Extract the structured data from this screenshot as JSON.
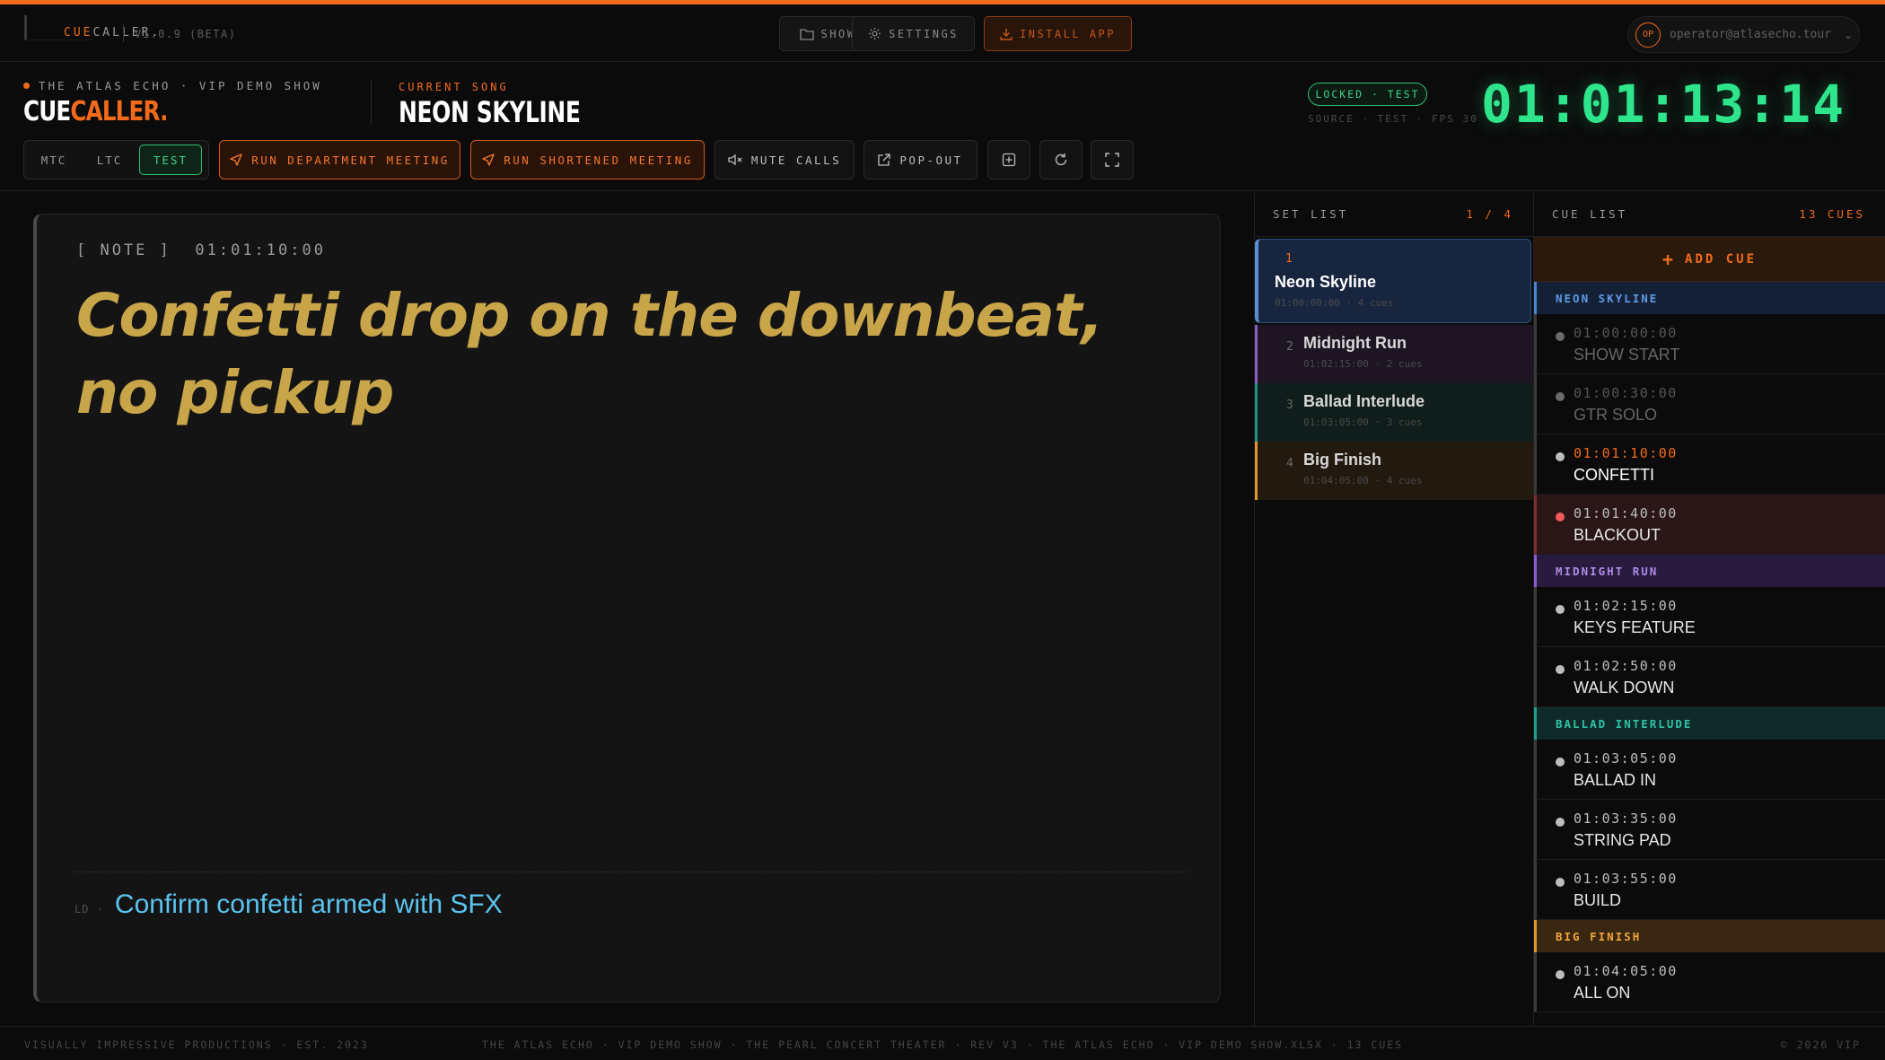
{
  "app": {
    "brand_prefix": "CUE",
    "brand_suffix": "CALLER.",
    "version": "V1.0.9 (BETA)"
  },
  "topnav": {
    "show_label": "SHOW",
    "settings_label": "SETTINGS",
    "install_label": "INSTALL APP",
    "user_initials": "OP",
    "user_email": "operator@atlasecho.tour"
  },
  "header": {
    "show_line": "THE ATLAS ECHO · VIP DEMO SHOW",
    "logo_a": "CUE",
    "logo_b": "CALLER.",
    "current_song_label": "CURRENT SONG",
    "current_song_name": "NEON SKYLINE",
    "lock_status": "LOCKED · TEST",
    "source_line": "SOURCE · TEST · FPS 30",
    "timecode": "01:01:13:14"
  },
  "toolbar": {
    "modes": [
      "MTC",
      "LTC",
      "TEST"
    ],
    "active_mode": "TEST",
    "run_department_meeting": "RUN DEPARTMENT MEETING",
    "run_shortened_meeting": "RUN SHORTENED MEETING",
    "mute_calls": "MUTE CALLS",
    "pop_out": "POP-OUT"
  },
  "note": {
    "tag": "[ NOTE ]",
    "timecode": "01:01:10:00",
    "text": "Confetti drop on the downbeat, no pickup",
    "dept": "LD ·",
    "action": "Confirm confetti armed with SFX"
  },
  "setlist": {
    "title": "SET LIST",
    "count": "1 / 4",
    "songs": [
      {
        "num": "1",
        "title": "Neon Skyline",
        "meta": "01:00:00:00 · 4 cues"
      },
      {
        "num": "2",
        "title": "Midnight Run",
        "meta": "01:02:15:00 · 2 cues"
      },
      {
        "num": "3",
        "title": "Ballad Interlude",
        "meta": "01:03:05:00 · 3 cues"
      },
      {
        "num": "4",
        "title": "Big Finish",
        "meta": "01:04:05:00 · 4 cues"
      }
    ]
  },
  "cuelist": {
    "title": "CUE LIST",
    "count": "13 CUES",
    "add_label": "ADD CUE",
    "sections": [
      {
        "name": "NEON SKYLINE",
        "cues": [
          {
            "tc": "01:00:00:00",
            "name": "SHOW START"
          },
          {
            "tc": "01:00:30:00",
            "name": "GTR SOLO"
          },
          {
            "tc": "01:01:10:00",
            "name": "CONFETTI"
          },
          {
            "tc": "01:01:40:00",
            "name": "BLACKOUT"
          }
        ]
      },
      {
        "name": "MIDNIGHT RUN",
        "cues": [
          {
            "tc": "01:02:15:00",
            "name": "KEYS FEATURE"
          },
          {
            "tc": "01:02:50:00",
            "name": "WALK DOWN"
          }
        ]
      },
      {
        "name": "BALLAD INTERLUDE",
        "cues": [
          {
            "tc": "01:03:05:00",
            "name": "BALLAD IN"
          },
          {
            "tc": "01:03:35:00",
            "name": "STRING PAD"
          },
          {
            "tc": "01:03:55:00",
            "name": "BUILD"
          }
        ]
      },
      {
        "name": "BIG FINISH",
        "cues": [
          {
            "tc": "01:04:05:00",
            "name": "ALL ON"
          }
        ]
      }
    ]
  },
  "footer": {
    "left": "VISUALLY IMPRESSIVE PRODUCTIONS · EST. 2023",
    "center": "THE ATLAS ECHO · VIP DEMO SHOW · THE PEARL CONCERT THEATER · REV V3 · THE ATLAS ECHO · VIP DEMO SHOW.XLSX · 13 CUES",
    "right": "© 2026 VIP"
  },
  "colors": {
    "accent": "#f26a1b",
    "timecode_green": "#2ee58c",
    "note_gold": "#c9a54a",
    "action_blue": "#5bc4ee"
  }
}
